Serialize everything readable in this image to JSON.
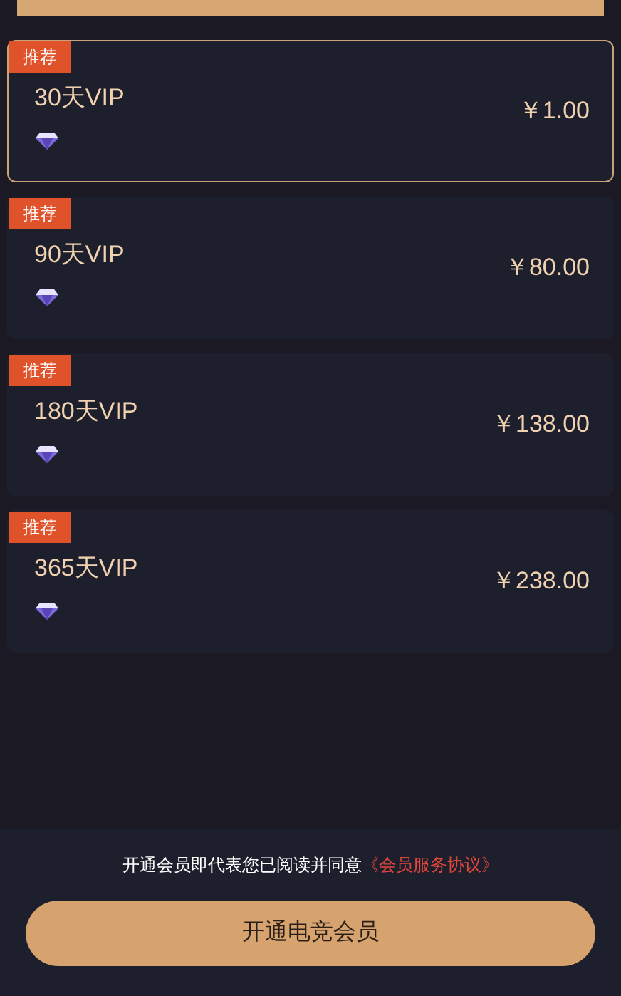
{
  "plans": [
    {
      "badge": "推荐",
      "name": "30天VIP",
      "price": "￥1.00",
      "selected": true
    },
    {
      "badge": "推荐",
      "name": "90天VIP",
      "price": "￥80.00",
      "selected": false
    },
    {
      "badge": "推荐",
      "name": "180天VIP",
      "price": "￥138.00",
      "selected": false
    },
    {
      "badge": "推荐",
      "name": "365天VIP",
      "price": "￥238.00",
      "selected": false
    }
  ],
  "agreement": {
    "text": "开通会员即代表您已阅读并同意",
    "link": "《会员服务协议》"
  },
  "submit_button": "开通电竞会员"
}
